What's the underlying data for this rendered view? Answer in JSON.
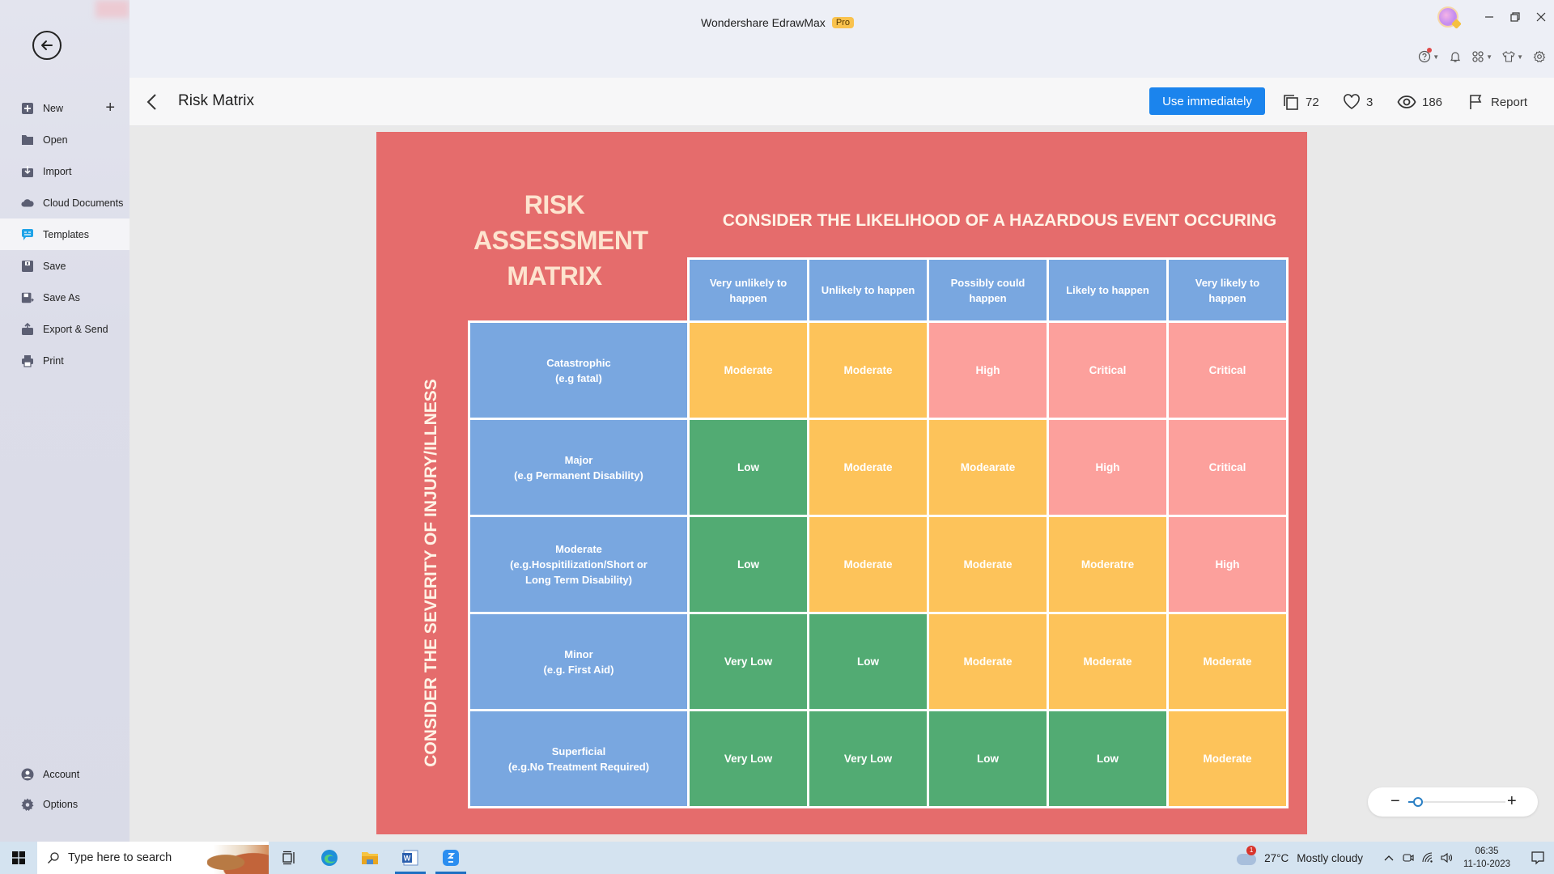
{
  "titlebar": {
    "app_name": "Wondershare EdrawMax",
    "badge": "Pro"
  },
  "sidebar": {
    "items": [
      {
        "label": "New",
        "icon": "new-plus-square-icon"
      },
      {
        "label": "Open",
        "icon": "folder-icon"
      },
      {
        "label": "Import",
        "icon": "import-icon"
      },
      {
        "label": "Cloud Documents",
        "icon": "cloud-icon"
      },
      {
        "label": "Templates",
        "icon": "templates-icon",
        "active": true
      },
      {
        "label": "Save",
        "icon": "save-icon"
      },
      {
        "label": "Save As",
        "icon": "save-as-icon"
      },
      {
        "label": "Export & Send",
        "icon": "export-icon"
      },
      {
        "label": "Print",
        "icon": "printer-icon"
      }
    ],
    "bottom_items": [
      {
        "label": "Account",
        "icon": "account-icon"
      },
      {
        "label": "Options",
        "icon": "gear-icon"
      }
    ]
  },
  "header": {
    "title": "Risk Matrix",
    "use_button": "Use immediately",
    "duplicates": "72",
    "likes": "3",
    "views": "186",
    "report": "Report"
  },
  "diagram": {
    "title_lines": [
      "RISK",
      "ASSESSMENT",
      "MATRIX"
    ],
    "likelihood_title": "CONSIDER THE LIKELIHOOD OF A HAZARDOUS EVENT OCCURING",
    "severity_title": "CONSIDER THE SEVERITY OF INJURY/ILLNESS",
    "columns": [
      "Very unlikely to happen",
      "Unlikely to happen",
      "Possibly could happen",
      "Likely to happen",
      "Very likely to happen"
    ],
    "rows": [
      {
        "label": "Catastrophic",
        "sub": "(e.g fatal)",
        "cells": [
          "Moderate",
          "Moderate",
          "High",
          "Critical",
          "Critical"
        ]
      },
      {
        "label": "Major",
        "sub": "(e.g Permanent Disability)",
        "cells": [
          "Low",
          "Moderate",
          "Modearate",
          "High",
          "Critical"
        ]
      },
      {
        "label": "Moderate",
        "sub": "(e.g.Hospitilization/Short or Long Term Disability)",
        "cells": [
          "Low",
          "Moderate",
          "Moderate",
          "Moderatre",
          "High"
        ]
      },
      {
        "label": "Minor",
        "sub": "(e.g. First Aid)",
        "cells": [
          "Very Low",
          "Low",
          "Moderate",
          "Moderate",
          "Moderate"
        ]
      },
      {
        "label": "Superficial",
        "sub": "(e.g.No Treatment Required)",
        "cells": [
          "Very Low",
          "Very Low",
          "Low",
          "Low",
          "Moderate"
        ]
      }
    ],
    "level_colors": {
      "Very Low": "#52ab73",
      "Low": "#52ab73",
      "Moderate": "#fdc35a",
      "High": "#fca09c",
      "Critical": "#fca09c"
    },
    "colors": {
      "background": "#e56c6c",
      "header_blue": "#79a7e0"
    }
  },
  "zoom": {
    "level_fraction": 0.1
  },
  "taskbar": {
    "search_placeholder": "Type here to search",
    "weather_temp": "27°C",
    "weather_text": "Mostly cloudy",
    "weather_badge": "1",
    "time": "06:35",
    "date": "11-10-2023"
  }
}
